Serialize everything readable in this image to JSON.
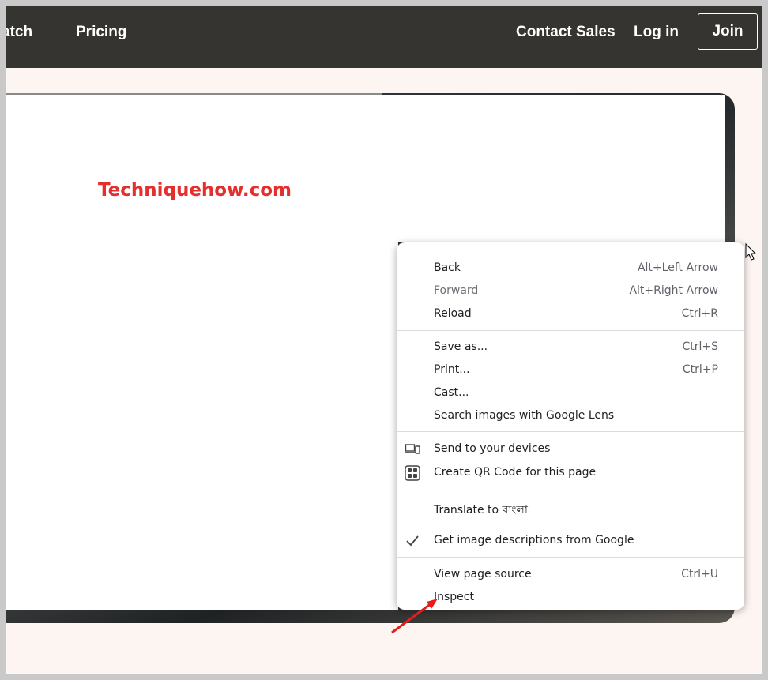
{
  "nav": {
    "partial_link": "atch",
    "pricing": "Pricing",
    "contact_sales": "Contact Sales",
    "login": "Log in",
    "join": "Join"
  },
  "watermark": "Techniquehow.com",
  "context_menu": {
    "back": {
      "label": "Back",
      "shortcut": "Alt+Left Arrow"
    },
    "forward": {
      "label": "Forward",
      "shortcut": "Alt+Right Arrow"
    },
    "reload": {
      "label": "Reload",
      "shortcut": "Ctrl+R"
    },
    "save_as": {
      "label": "Save as...",
      "shortcut": "Ctrl+S"
    },
    "print": {
      "label": "Print...",
      "shortcut": "Ctrl+P"
    },
    "cast": {
      "label": "Cast..."
    },
    "google_lens": {
      "label": "Search images with Google Lens"
    },
    "send_devices": {
      "label": "Send to your devices",
      "icon": "devices-icon"
    },
    "qr_code": {
      "label": "Create QR Code for this page",
      "icon": "qr-code-icon"
    },
    "translate": {
      "label": "Translate to বাংলা"
    },
    "image_descriptions": {
      "label": "Get image descriptions from Google",
      "icon": "checkmark-icon",
      "checked": true
    },
    "view_source": {
      "label": "View page source",
      "shortcut": "Ctrl+U"
    },
    "inspect": {
      "label": "Inspect"
    }
  },
  "colors": {
    "nav_bg": "#353430",
    "page_bg": "#fdf5f1",
    "watermark": "#e52f2f",
    "annotation_arrow": "#e51c1c"
  }
}
